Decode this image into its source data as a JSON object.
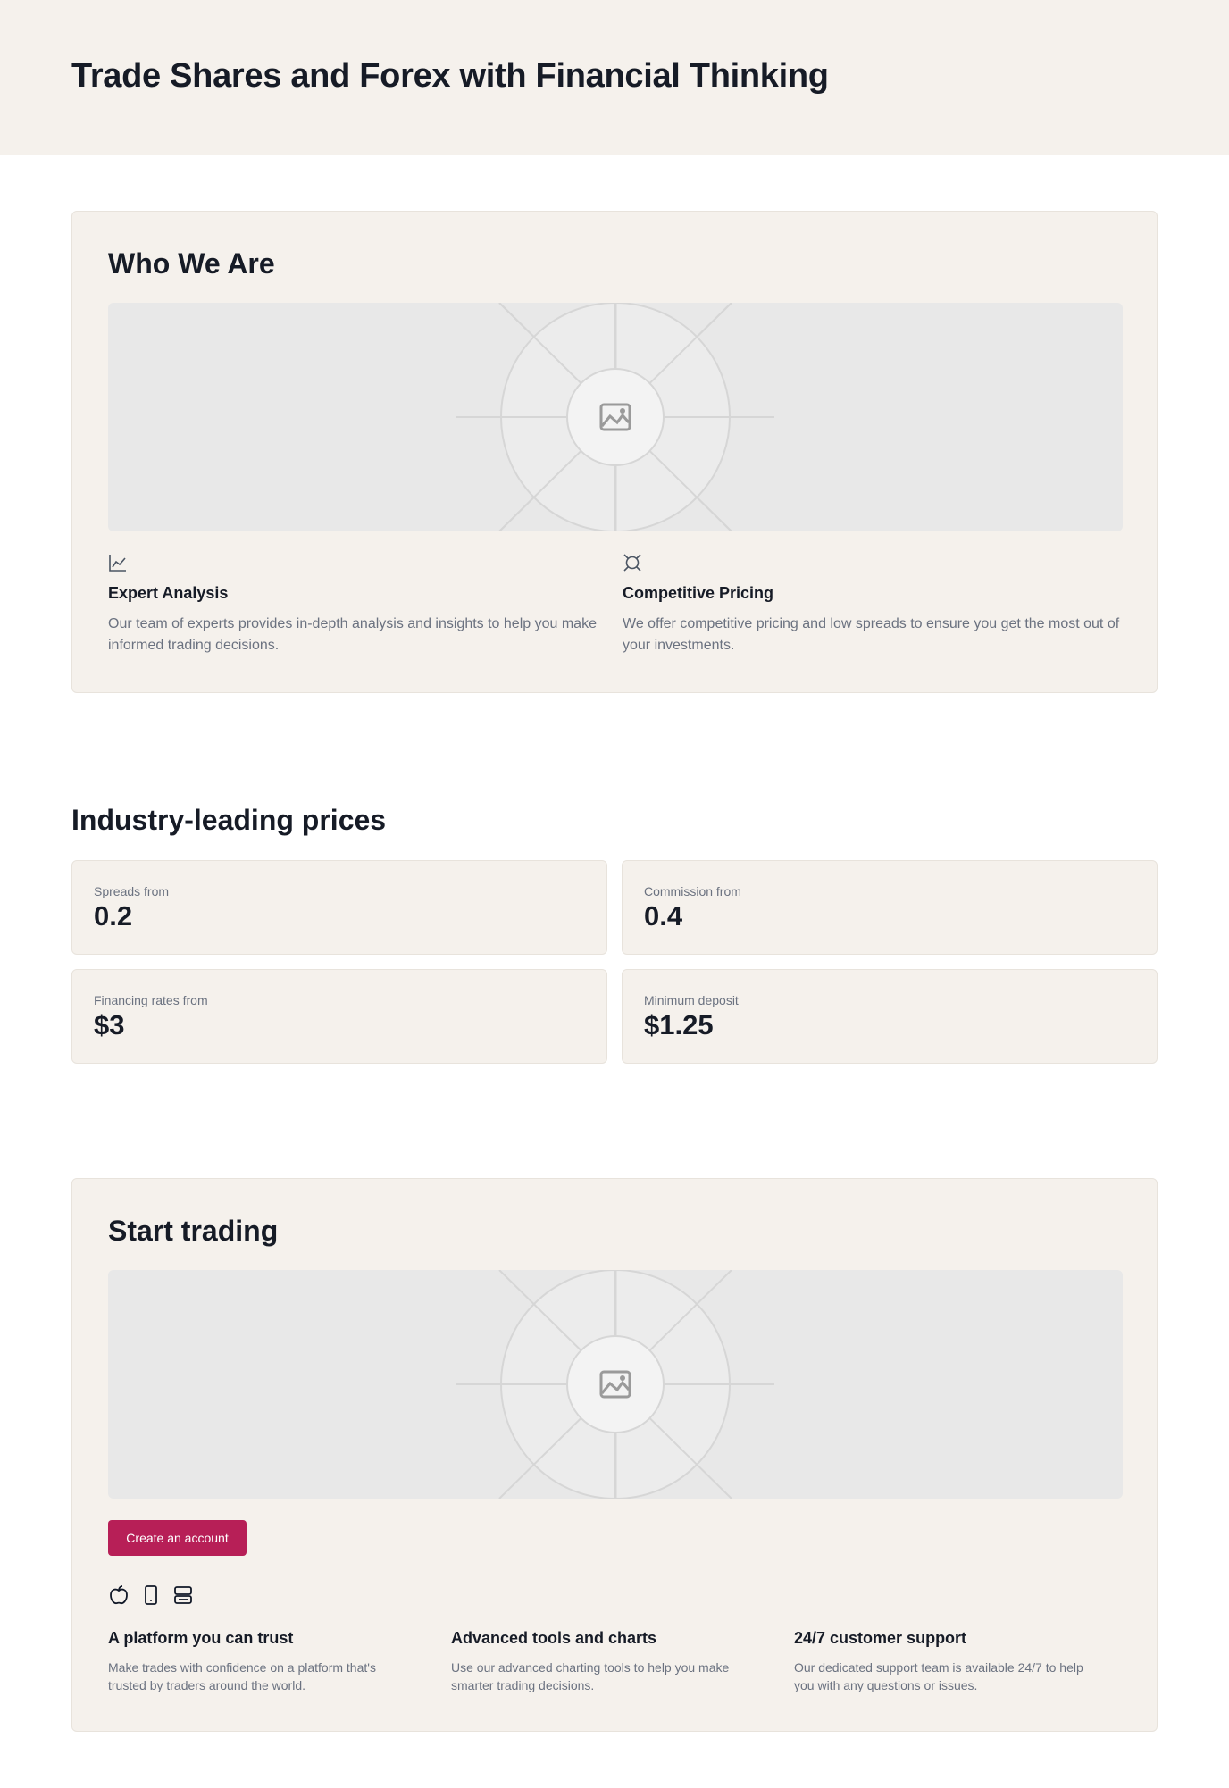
{
  "hero": {
    "title": "Trade Shares and Forex with Financial Thinking"
  },
  "about": {
    "title": "Who We Are",
    "image_icon": "image-icon",
    "features": [
      {
        "icon": "line-chart-icon",
        "title": "Expert Analysis",
        "description": "Our team of experts provides in-depth analysis and insights to help you make informed trading decisions."
      },
      {
        "icon": "currency-icon",
        "title": "Competitive Pricing",
        "description": "We offer competitive pricing and low spreads to ensure you get the most out of your investments."
      }
    ]
  },
  "prices": {
    "title": "Industry-leading prices",
    "stats": [
      {
        "label": "Spreads from",
        "value": "0.2"
      },
      {
        "label": "Commission from",
        "value": "0.4"
      },
      {
        "label": "Financing rates from",
        "value": "$3"
      },
      {
        "label": "Minimum deposit",
        "value": "$1.25"
      }
    ]
  },
  "start": {
    "title": "Start trading",
    "image_icon": "image-icon",
    "button_label": "Create an account",
    "icons": [
      "apple-icon",
      "mobile-phone-icon",
      "server-icon"
    ],
    "columns": [
      {
        "title": "A platform you can trust",
        "description": "Make trades with confidence on a platform that's trusted by traders around the world."
      },
      {
        "title": "Advanced tools and charts",
        "description": "Use our advanced charting tools to help you make smarter trading decisions."
      },
      {
        "title": "24/7 customer support",
        "description": "Our dedicated support team is available 24/7 to help you with any questions or issues."
      }
    ]
  },
  "colors": {
    "accent": "#b71f57",
    "panel": "#f5f1ec",
    "placeholder": "#e8e8e8"
  }
}
